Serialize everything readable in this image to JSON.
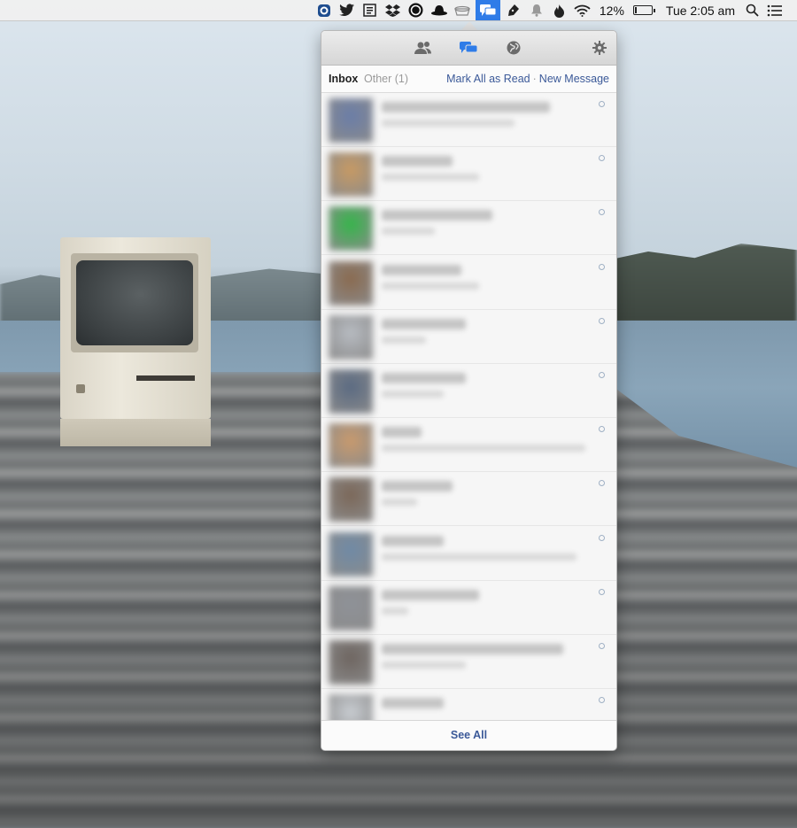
{
  "menubar": {
    "icons": [
      "ring-app-icon",
      "twitter-icon",
      "reader-icon",
      "dropbox-icon",
      "circle-app-icon",
      "bowler-hat-icon",
      "cloud-app-icon",
      "facebook-messages-icon",
      "pen-icon",
      "notification-bell-icon",
      "flame-icon",
      "wifi-icon"
    ],
    "battery_percent_label": "12%",
    "battery_level": 0.12,
    "clock": "Tue 2:05 am"
  },
  "popover": {
    "toolbar": {
      "friends_icon": "friends-icon",
      "messages_icon": "messages-icon",
      "notifications_icon": "globe-icon",
      "settings_icon": "gear-icon",
      "active_color": "#2f7ce8"
    },
    "tabs": {
      "inbox_label": "Inbox",
      "other_label": "Other",
      "other_count": "(1)"
    },
    "actions": {
      "mark_all_read": "Mark All as Read",
      "separator": "·",
      "new_message": "New Message"
    },
    "conversations": [
      {
        "avatar_color": "#6a7da8"
      },
      {
        "avatar_color": "#c89a63"
      },
      {
        "avatar_color": "#35b54a"
      },
      {
        "avatar_color": "#8a6a4f"
      },
      {
        "avatar_color": "#b8bcc2"
      },
      {
        "avatar_color": "#5a6a82"
      },
      {
        "avatar_color": "#c99a6d"
      },
      {
        "avatar_color": "#7b6758"
      },
      {
        "avatar_color": "#6f8aa6"
      },
      {
        "avatar_color": "#8f9298"
      },
      {
        "avatar_color": "#6e6560"
      },
      {
        "avatar_color": "#c9cdd2"
      }
    ],
    "footer": {
      "see_all": "See All"
    }
  }
}
